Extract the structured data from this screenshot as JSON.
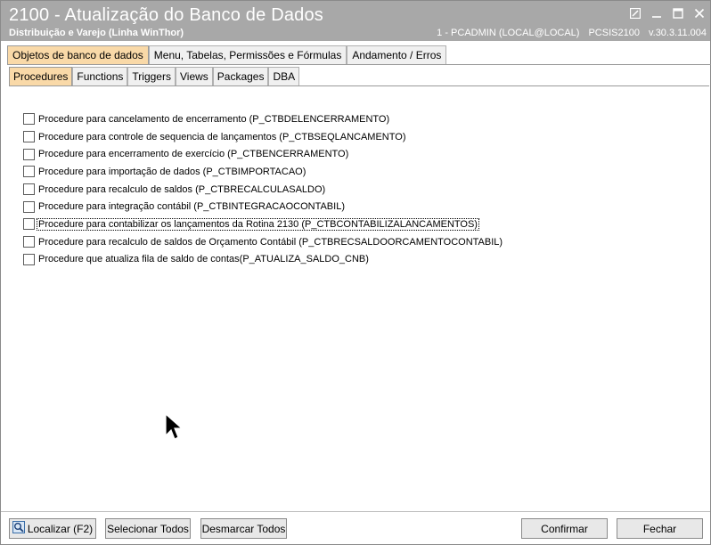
{
  "window": {
    "title": "2100 - Atualização do Banco de Dados",
    "subtitle": "Distribuição e Varejo (Linha WinThor)",
    "user": "1 - PCADMIN (LOCAL@LOCAL)",
    "program": "PCSIS2100",
    "version": "v.30.3.11.004"
  },
  "main_tabs": [
    {
      "label": "Objetos de banco de dados",
      "active": true
    },
    {
      "label": "Menu, Tabelas, Permissões e Fórmulas",
      "active": false
    },
    {
      "label": "Andamento / Erros",
      "active": false
    }
  ],
  "sub_tabs": [
    {
      "label": "Procedures",
      "active": true
    },
    {
      "label": "Functions",
      "active": false
    },
    {
      "label": "Triggers",
      "active": false
    },
    {
      "label": "Views",
      "active": false
    },
    {
      "label": "Packages",
      "active": false
    },
    {
      "label": "DBA",
      "active": false
    }
  ],
  "procedures": [
    {
      "label": "Procedure para cancelamento de encerramento (P_CTBDELENCERRAMENTO)",
      "checked": false
    },
    {
      "label": "Procedure para controle de sequencia de lançamentos (P_CTBSEQLANCAMENTO)",
      "checked": false
    },
    {
      "label": "Procedure para encerramento de exercício (P_CTBENCERRAMENTO)",
      "checked": false
    },
    {
      "label": "Procedure para importação de dados (P_CTBIMPORTACAO)",
      "checked": false
    },
    {
      "label": "Procedure para recalculo de saldos (P_CTBRECALCULASALDO)",
      "checked": false
    },
    {
      "label": "Procedure para integração contábil (P_CTBINTEGRACAOCONTABIL)",
      "checked": false
    },
    {
      "label": "Procedure para contabilizar os lançamentos da Rotina 2130 (P_CTBCONTABILIZALANCAMENTOS)",
      "checked": false,
      "focused": true
    },
    {
      "label": "Procedure para recalculo de saldos de Orçamento Contábil (P_CTBRECSALDOORCAMENTOCONTABIL)",
      "checked": false
    },
    {
      "label": "Procedure que atualiza fila de saldo de contas(P_ATUALIZA_SALDO_CNB)",
      "checked": false
    }
  ],
  "footer": {
    "localizar": "Localizar (F2)",
    "selecionar_todos": "Selecionar Todos",
    "desmarcar_todos": "Desmarcar Todos",
    "confirmar": "Confirmar",
    "fechar": "Fechar"
  },
  "colors": {
    "titlebar": "#a8a8a8",
    "active_tab": "#f9d9a8"
  },
  "icons": {
    "search": "search-icon",
    "restore": "restore-icon",
    "minimize": "minimize-icon",
    "maximize": "maximize-icon",
    "close": "close-icon",
    "cursor": "mouse-pointer-icon"
  }
}
